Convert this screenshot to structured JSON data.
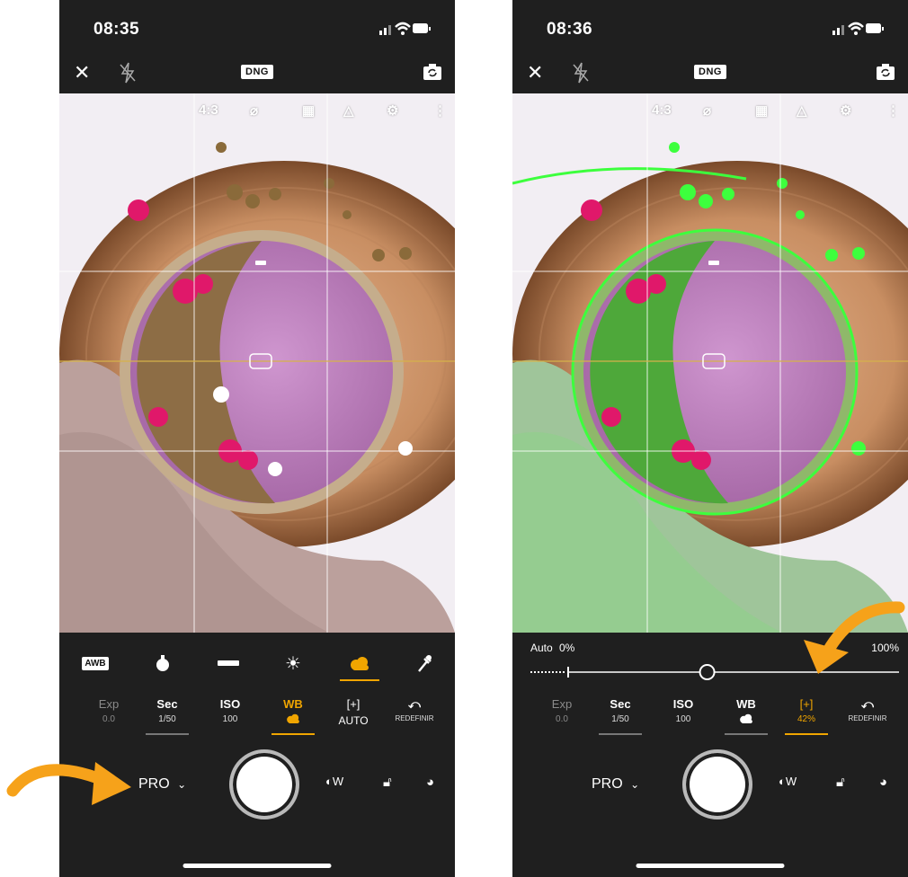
{
  "left": {
    "status": {
      "time": "08:35"
    },
    "topbar": {
      "dng_label": "DNG"
    },
    "overlay": {
      "aspect_label": "4:3"
    },
    "modes": [
      {
        "name": "awb",
        "label": "AWB"
      },
      {
        "name": "incandescent"
      },
      {
        "name": "fluorescent"
      },
      {
        "name": "daylight"
      },
      {
        "name": "cloudy",
        "active": true
      },
      {
        "name": "eyedropper"
      }
    ],
    "params": [
      {
        "name": "Exp",
        "value": "0.0",
        "state": "dim"
      },
      {
        "name": "Sec",
        "value": "1/50",
        "state": "underline"
      },
      {
        "name": "ISO",
        "value": "100",
        "state": "normal"
      },
      {
        "name": "WB",
        "value": "",
        "state": "active"
      },
      {
        "name": "[+]",
        "value": "AUTO",
        "state": "normal"
      },
      {
        "name": "",
        "value": "REDEFINIR",
        "state": "normal"
      }
    ],
    "mode_selector": "PRO",
    "right_icon_label": "W"
  },
  "right": {
    "status": {
      "time": "08:36"
    },
    "topbar": {
      "dng_label": "DNG"
    },
    "overlay": {
      "aspect_label": "4:3"
    },
    "slider": {
      "label_auto": "Auto",
      "label_min": "0%",
      "label_max": "100%",
      "value": 0.42
    },
    "params": [
      {
        "name": "Exp",
        "value": "0.0",
        "state": "dim"
      },
      {
        "name": "Sec",
        "value": "1/50",
        "state": "underline"
      },
      {
        "name": "ISO",
        "value": "100",
        "state": "normal"
      },
      {
        "name": "WB",
        "value": "",
        "state": "underline"
      },
      {
        "name": "[+]",
        "value": "42%",
        "state": "active"
      },
      {
        "name": "",
        "value": "REDEFINIR",
        "state": "normal"
      }
    ],
    "mode_selector": "PRO",
    "right_icon_label": "W"
  },
  "colors": {
    "accent": "#f0a500",
    "arrow": "#f6a21a",
    "focus_peaking": "#3dff3d"
  }
}
